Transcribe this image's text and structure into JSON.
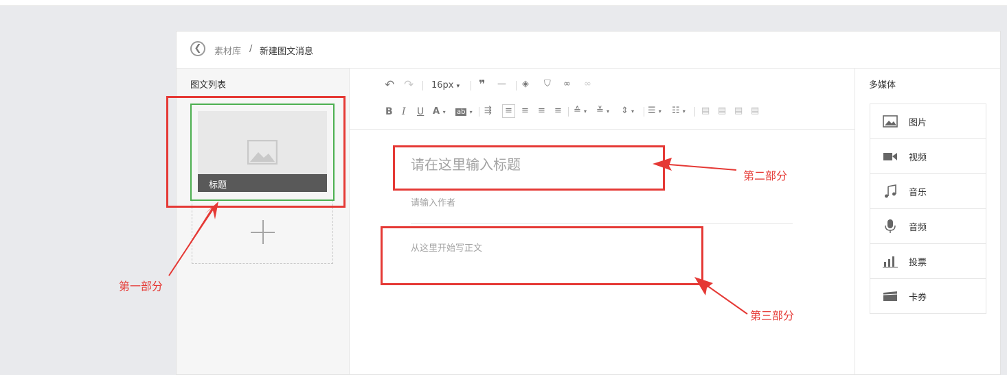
{
  "breadcrumb": {
    "parent": "素材库",
    "separator": "/",
    "current": "新建图文消息"
  },
  "left_panel": {
    "title": "图文列表",
    "thumb_title": "标题"
  },
  "toolbar": {
    "font_size": "16px",
    "dropdown_caret": "▾"
  },
  "editor": {
    "title_placeholder": "请在这里输入标题",
    "author_placeholder": "请输入作者",
    "body_placeholder": "从这里开始写正文"
  },
  "media_panel": {
    "title": "多媒体",
    "items": [
      {
        "label": "图片",
        "icon": "image-icon"
      },
      {
        "label": "视频",
        "icon": "video-icon"
      },
      {
        "label": "音乐",
        "icon": "music-icon"
      },
      {
        "label": "音频",
        "icon": "microphone-icon"
      },
      {
        "label": "投票",
        "icon": "bar-chart-icon"
      },
      {
        "label": "卡券",
        "icon": "card-icon"
      }
    ]
  },
  "annotations": {
    "part1": "第一部分",
    "part2": "第二部分",
    "part3": "第三部分",
    "color": "#e53935"
  },
  "colors": {
    "accent_green": "#4caf50",
    "thumb_bar": "#595959"
  }
}
